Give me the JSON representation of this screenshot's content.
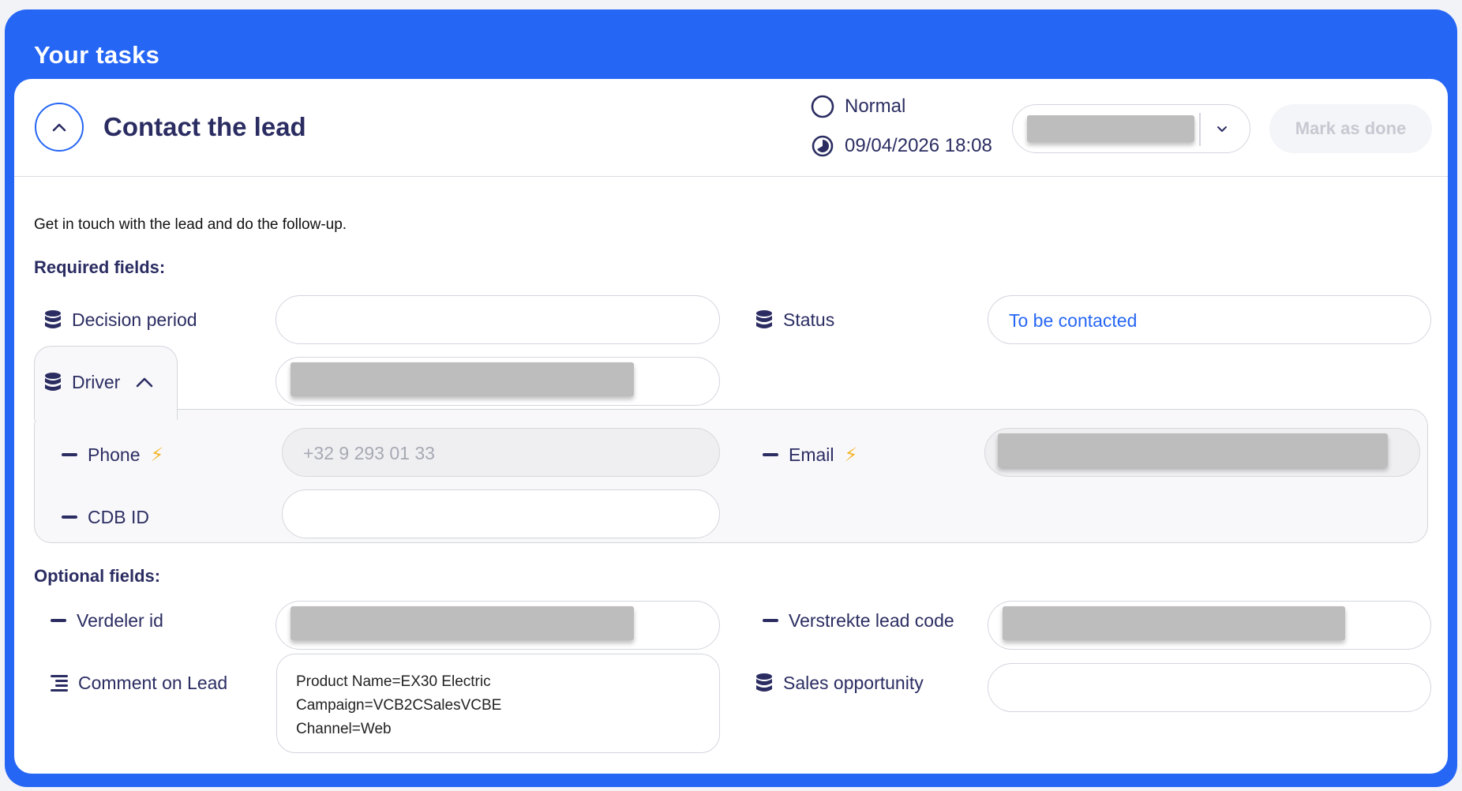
{
  "panel": {
    "title": "Your tasks"
  },
  "task": {
    "title": "Contact the lead",
    "priority": "Normal",
    "due": "09/04/2026 18:08",
    "mark_done_label": "Mark as done",
    "description": "Get in touch with the lead and do the follow-up."
  },
  "sections": {
    "required": "Required fields:",
    "optional": "Optional fields:"
  },
  "fields": {
    "decision_period": {
      "label": "Decision period",
      "value": ""
    },
    "status": {
      "label": "Status",
      "value": "To be contacted"
    },
    "driver": {
      "label": "Driver"
    },
    "phone": {
      "label": "Phone",
      "value": "+32 9 293 01 33"
    },
    "email": {
      "label": "Email"
    },
    "cdb_id": {
      "label": "CDB ID",
      "value": ""
    },
    "verdeler_id": {
      "label": "Verdeler id"
    },
    "verstrekte_lead_code": {
      "label": "Verstrekte lead code"
    },
    "comment": {
      "label": "Comment on Lead",
      "lines": [
        "Product Name=EX30 Electric",
        "Campaign=VCB2CSalesVCBE",
        "Channel=Web"
      ]
    },
    "sales_opportunity": {
      "label": "Sales opportunity",
      "value": ""
    }
  },
  "colors": {
    "accent": "#2666f5",
    "text": "#2b2d62",
    "lightning": "#f5b52a"
  },
  "icons": {
    "priority": "circle-outline-icon",
    "due": "clock-icon",
    "lookup": "database-icon",
    "text_field": "dash-icon",
    "multiline": "lines-icon",
    "auto_filled": "lightning-icon"
  }
}
